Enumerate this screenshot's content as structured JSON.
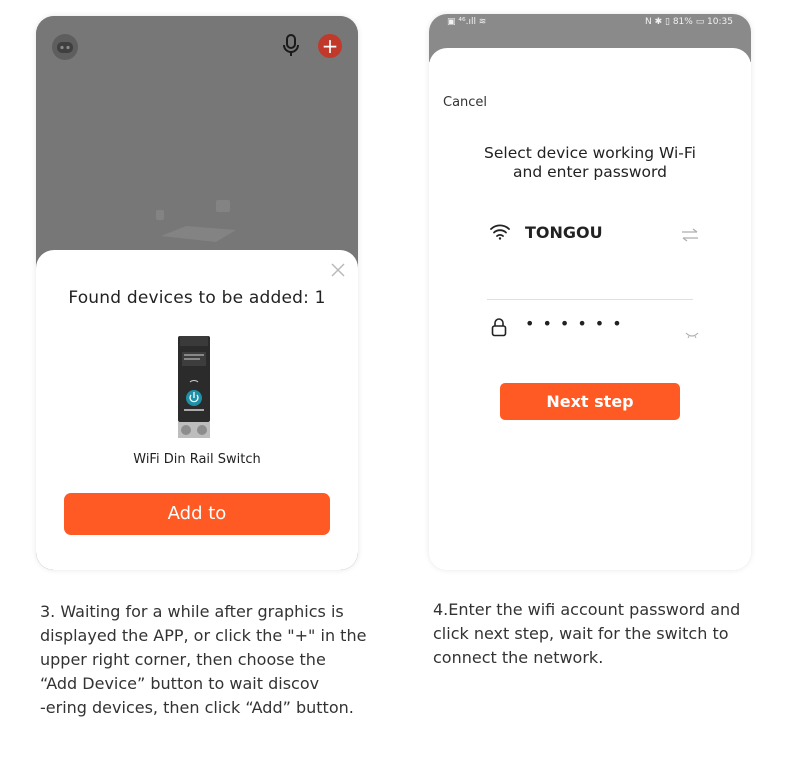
{
  "left_screen": {
    "sheet_title": "Found devices to be added: 1",
    "device_name": "WiFi Din Rail Switch",
    "add_button": "Add to",
    "plus_symbol": "+",
    "icons": [
      "bot-avatar-icon",
      "microphone-icon",
      "plus-icon",
      "close-icon"
    ],
    "accent": "#ff5a24"
  },
  "right_screen": {
    "status_left": "▣ ⁴⁶.ıll ≋",
    "status_right": "N ✱ ▯ 81% ▭ 10:35",
    "cancel": "Cancel",
    "title_line1": "Select device working Wi-Fi",
    "title_line2": "and enter password",
    "ssid": "TONGOU",
    "password_mask": "••••••",
    "next_button": "Next step",
    "icons": [
      "wifi-icon",
      "switch-network-icon",
      "lock-icon",
      "eye-closed-icon"
    ],
    "accent": "#ff5a24"
  },
  "captions": {
    "left": [
      "3. Waiting for a while after graphics is",
      "displayed the APP, or click the \"+\" in the",
      "upper right corner, then choose the",
      "“Add Device” button to wait discov",
      "-ering devices, then click “Add” button."
    ],
    "right": [
      "4.Enter the wifi account password and",
      "click next step, wait for the switch to",
      "connect the network."
    ]
  }
}
